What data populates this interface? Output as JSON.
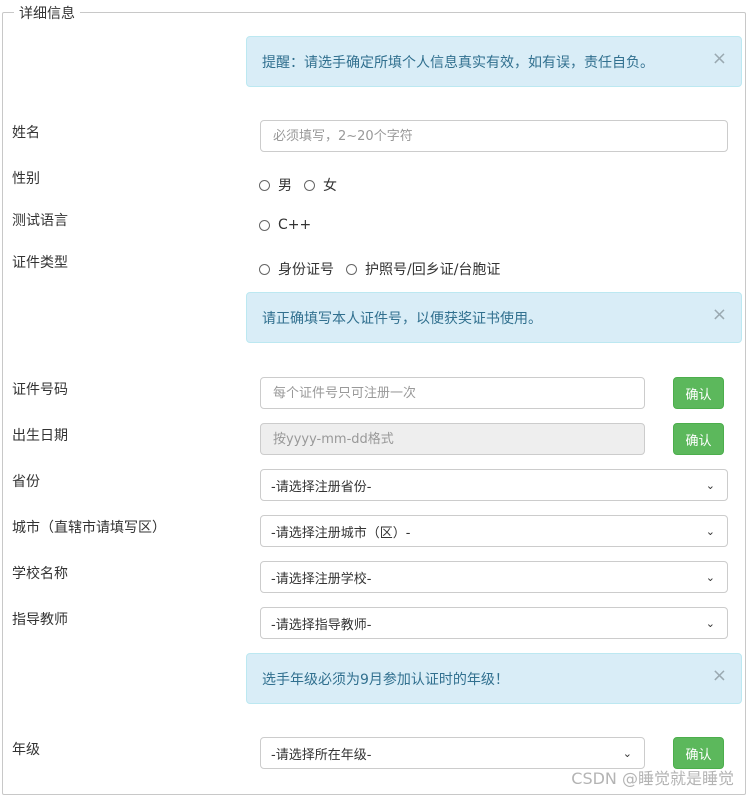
{
  "legend": "详细信息",
  "alerts": [
    "提醒：请选手确定所填个人信息真实有效，如有误，责任自负。",
    "请正确填写本人证件号，以便获奖证书使用。",
    "选手年级必须为9月参加认证时的年级！"
  ],
  "close_glyph": "×",
  "fields": {
    "name": {
      "label": "姓名",
      "placeholder": "必须填写，2~20个字符"
    },
    "gender": {
      "label": "性别",
      "options": [
        "男",
        "女"
      ]
    },
    "language": {
      "label": "测试语言",
      "options": [
        "C++"
      ]
    },
    "id_type": {
      "label": "证件类型",
      "options": [
        "身份证号",
        "护照号/回乡证/台胞证"
      ]
    },
    "id_number": {
      "label": "证件号码",
      "placeholder": "每个证件号只可注册一次",
      "button": "确认"
    },
    "birth": {
      "label": "出生日期",
      "placeholder": "按yyyy-mm-dd格式",
      "button": "确认"
    },
    "province": {
      "label": "省份",
      "value": "-请选择注册省份-"
    },
    "city": {
      "label": "城市（直辖市请填写区）",
      "value": "-请选择注册城市（区）-"
    },
    "school": {
      "label": "学校名称",
      "value": "-请选择注册学校-"
    },
    "teacher": {
      "label": "指导教师",
      "value": "-请选择指导教师-"
    },
    "grade": {
      "label": "年级",
      "value": "-请选择所在年级-",
      "button": "确认"
    }
  },
  "watermark": "CSDN @睡觉就是睡觉",
  "colors": {
    "alert_bg": "#d9edf7",
    "alert_text": "#31708f",
    "button_green": "#5cb85c"
  }
}
